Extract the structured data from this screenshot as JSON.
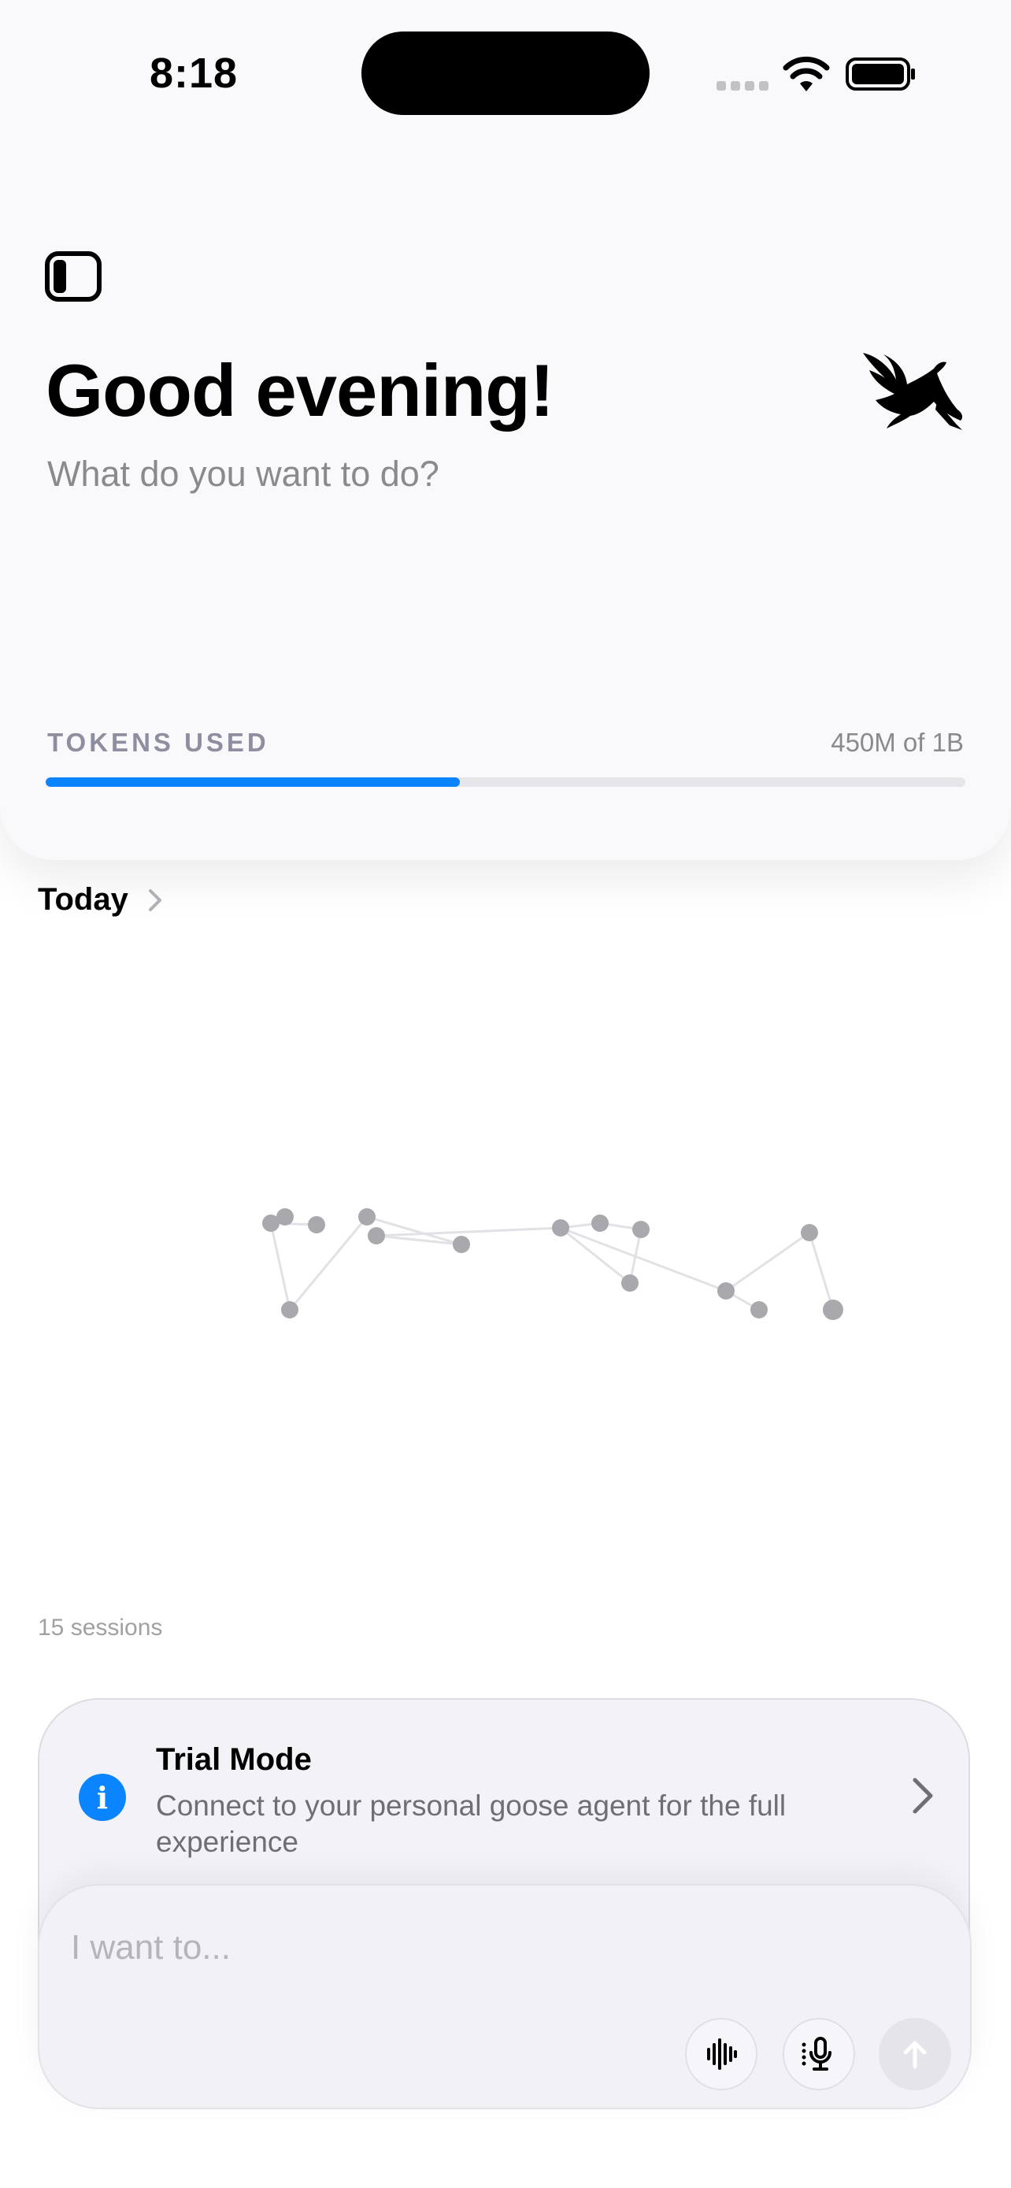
{
  "status_bar": {
    "time": "8:18"
  },
  "header": {
    "greeting": "Good evening!",
    "subtitle": "What do you want to do?",
    "tokens_label": "TOKENS USED",
    "tokens_value": "450M of 1B",
    "tokens_used_fraction": 0.45
  },
  "today": {
    "label": "Today"
  },
  "sessions": {
    "count_text": "15 sessions"
  },
  "trial": {
    "title": "Trial Mode",
    "description": "Connect to your personal goose agent for the full experience"
  },
  "composer": {
    "placeholder": "I want to..."
  },
  "colors": {
    "accent": "#0a84ff",
    "track": "#e5e5ea",
    "node": "#a9a9ad",
    "edge": "#e2e2e6"
  },
  "icons": [
    "sidebar-toggle-icon",
    "goose-logo-icon",
    "info-icon",
    "chevron-right-icon",
    "waveform-icon",
    "microphone-icon",
    "arrow-up-icon",
    "wifi-icon",
    "battery-icon"
  ]
}
